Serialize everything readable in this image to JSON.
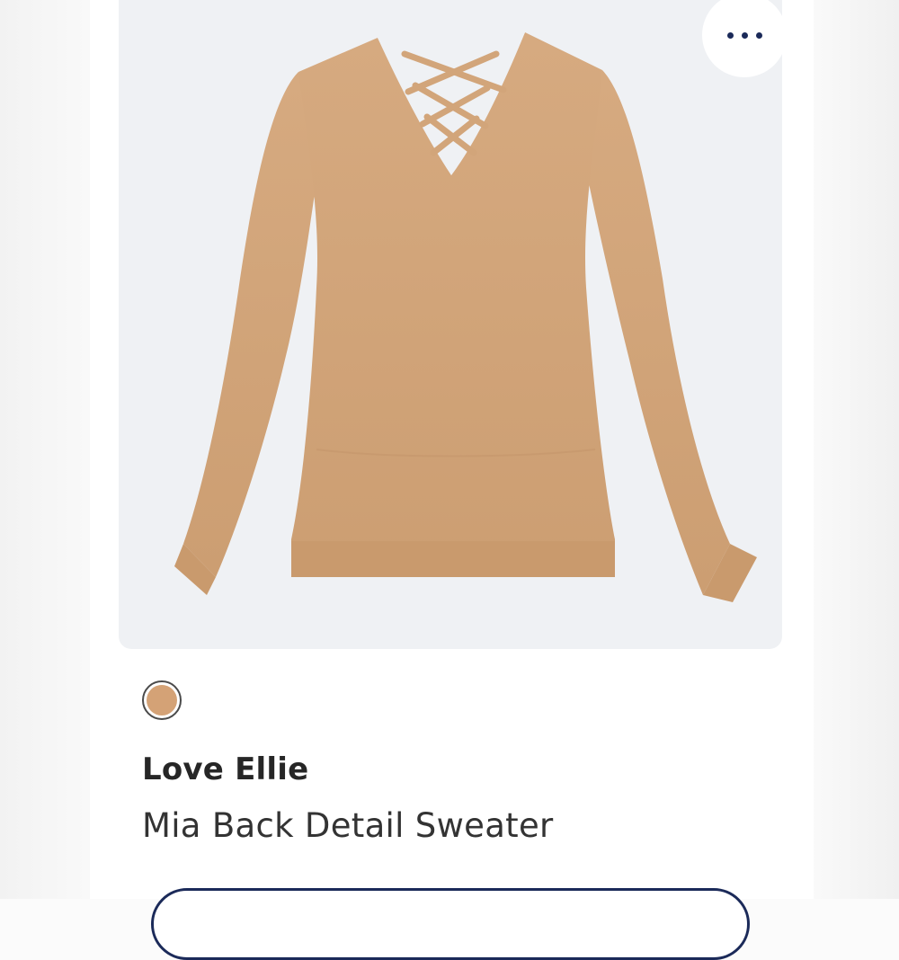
{
  "product": {
    "brand": "Love Ellie",
    "name": "Mia Back Detail Sweater",
    "image_subject": "sweater-image",
    "color_swatch": "#d4a276"
  },
  "actions": {
    "more_icon": "more-horizontal-icon"
  },
  "colors": {
    "accent": "#1b2a59",
    "image_background": "#eff1f4",
    "sweater": "#d2a57a"
  }
}
